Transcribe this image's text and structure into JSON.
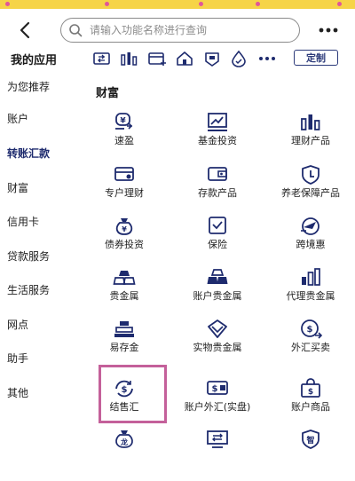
{
  "colors": {
    "top_strip": "#f6d447",
    "strip_dots": "#e0569a",
    "icon_navy": "#1e2b6e",
    "highlight_border": "#c4609a"
  },
  "search": {
    "placeholder": "请输入功能名称进行查询",
    "value": ""
  },
  "apps": {
    "title": "我的应用",
    "customize_label": "定制",
    "quick_icons": [
      "wallet-transfer-icon",
      "bar-chart-icon",
      "card-plus-icon",
      "house-icon",
      "shield-badge-icon",
      "drop-icon",
      "more-dots-icon"
    ]
  },
  "sidebar": {
    "items": [
      {
        "label": "为您推荐",
        "active": false
      },
      {
        "label": "账户",
        "active": false
      },
      {
        "label": "转账汇款",
        "active": true
      },
      {
        "label": "财富",
        "active": false
      },
      {
        "label": "信用卡",
        "active": false
      },
      {
        "label": "贷款服务",
        "active": false
      },
      {
        "label": "生活服务",
        "active": false
      },
      {
        "label": "网点",
        "active": false
      },
      {
        "label": "助手",
        "active": false
      },
      {
        "label": "其他",
        "active": false
      }
    ]
  },
  "section": {
    "title": "财富",
    "items": [
      {
        "label": "速盈",
        "icon": "yen-coins-icon"
      },
      {
        "label": "基金投资",
        "icon": "trend-chart-icon"
      },
      {
        "label": "理财产品",
        "icon": "bar-chart-icon"
      },
      {
        "label": "专户理财",
        "icon": "card-icon"
      },
      {
        "label": "存款产品",
        "icon": "wallet-icon"
      },
      {
        "label": "养老保障产品",
        "icon": "shield-check-icon"
      },
      {
        "label": "债券投资",
        "icon": "bond-bag-icon"
      },
      {
        "label": "保险",
        "icon": "insurance-check-icon"
      },
      {
        "label": "跨境惠",
        "icon": "plane-globe-icon"
      },
      {
        "label": "贵金属",
        "icon": "gold-bars-icon"
      },
      {
        "label": "账户贵金属",
        "icon": "gold-bars-icon"
      },
      {
        "label": "代理贵金属",
        "icon": "gold-chart-icon"
      },
      {
        "label": "易存金",
        "icon": "gold-stack-icon"
      },
      {
        "label": "实物贵金属",
        "icon": "diamond-icon"
      },
      {
        "label": "外汇买卖",
        "icon": "currency-exchange-icon"
      },
      {
        "label": "结售汇",
        "icon": "dollar-cycle-icon",
        "highlighted": true
      },
      {
        "label": "账户外汇(实盘)",
        "icon": "card-dollar-icon"
      },
      {
        "label": "账户商品",
        "icon": "shopping-bag-icon"
      },
      {
        "label": "",
        "icon": "dragon-bag-icon"
      },
      {
        "label": "",
        "icon": "monitor-icon"
      },
      {
        "label": "",
        "icon": "smart-shield-icon"
      }
    ]
  }
}
